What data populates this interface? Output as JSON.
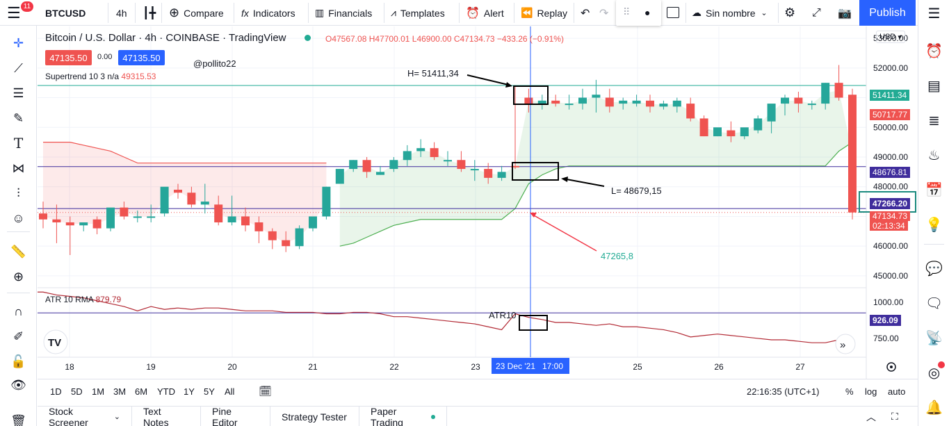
{
  "toolbar": {
    "notifications": "11",
    "symbol": "BTCUSD",
    "interval": "4h",
    "compare": "Compare",
    "indicators": "Indicators",
    "financials": "Financials",
    "templates": "Templates",
    "alert": "Alert",
    "replay": "Replay",
    "layout_name": "Sin nombre",
    "publish": "Publish"
  },
  "legend": {
    "title": "Bitcoin / U.S. Dollar · 4h · COINBASE · TradingView",
    "ohlc": "O47567.08 H47700.01 L46900.00 C47134.73 −433.26 (−0.91%)",
    "sell_price": "47135.50",
    "spread": "0.00",
    "buy_price": "47135.50",
    "supertrend_label": "Supertrend 10 3  n/a",
    "supertrend_value": "49315.53",
    "atr_label": "ATR 10 RMA",
    "atr_value": "879.79",
    "currency": "USD"
  },
  "annotations": {
    "author": "@pollito22",
    "high_note": "H= 51411,34",
    "low_note": "L= 48679,15",
    "supertrend_note": "47265,8",
    "atr_note": "ATR10"
  },
  "price_axis": {
    "ticks": [
      "53000.00",
      "52000.00",
      "51000.00",
      "50000.00",
      "49000.00",
      "48000.00",
      "47000.00",
      "46000.00",
      "45000.00"
    ],
    "atr_ticks": [
      "1000.00",
      "750.00"
    ],
    "labels": {
      "high_line": "51411.34",
      "upper_band": "50717.77",
      "low_line": "48676.81",
      "crosshair": "47266.20",
      "last_price": "47134.73",
      "countdown": "02:13:34",
      "atr_line": "926.09"
    }
  },
  "time_axis": {
    "ticks": [
      "18",
      "19",
      "20",
      "21",
      "22",
      "23",
      "25",
      "26",
      "27"
    ],
    "crosshair_label": "23 Dec '21   17:00"
  },
  "bottom": {
    "ranges": [
      "1D",
      "5D",
      "1M",
      "3M",
      "6M",
      "YTD",
      "1Y",
      "5Y",
      "All"
    ],
    "clock": "22:16:35 (UTC+1)",
    "percent": "%",
    "log": "log",
    "auto": "auto"
  },
  "tabs": [
    "Stock Screener",
    "Text Notes",
    "Pine Editor",
    "Strategy Tester",
    "Paper Trading"
  ],
  "colors": {
    "up": "#26a69a",
    "down": "#ef5350",
    "accent": "#2962ff",
    "high_line": "#22ab94",
    "low_line": "#3f2d9c",
    "atr_line": "#b22833",
    "crosshair": "#2962ff"
  },
  "chart_data": {
    "type": "candlestick",
    "ylim": [
      44600,
      53400
    ],
    "atr_ylim": [
      620,
      1100
    ],
    "candles": [
      [
        47100,
        47500,
        46900,
        46600
      ],
      [
        46900,
        47400,
        46800,
        46100
      ],
      [
        46800,
        47000,
        46700,
        45700
      ],
      [
        46700,
        46800,
        46800,
        46500
      ],
      [
        46900,
        47000,
        46600,
        46400
      ],
      [
        46600,
        47100,
        47300,
        46500
      ],
      [
        47300,
        47500,
        47000,
        46900
      ],
      [
        47000,
        47200,
        47000,
        46800
      ],
      [
        47000,
        47400,
        47000,
        46800
      ],
      [
        47100,
        47800,
        48000,
        47000
      ],
      [
        47900,
        48100,
        47800,
        47600
      ],
      [
        47800,
        48000,
        47400,
        47300
      ],
      [
        47400,
        48100,
        47500,
        47100
      ],
      [
        47400,
        47700,
        46800,
        46700
      ],
      [
        46800,
        47700,
        47000,
        46700
      ],
      [
        47000,
        47300,
        46700,
        46500
      ],
      [
        46800,
        47000,
        46500,
        46100
      ],
      [
        46500,
        46600,
        46200,
        45900
      ],
      [
        46200,
        46500,
        46000,
        45800
      ],
      [
        46000,
        46700,
        46600,
        45900
      ],
      [
        46600,
        47000,
        47000,
        46500
      ],
      [
        47000,
        48000,
        48000,
        46900
      ],
      [
        48100,
        48600,
        48600,
        48100
      ],
      [
        48600,
        48900,
        48900,
        48500
      ],
      [
        48900,
        49000,
        48500,
        48300
      ],
      [
        48400,
        48700,
        48500,
        48400
      ],
      [
        48600,
        49000,
        48900,
        48500
      ],
      [
        48900,
        49400,
        49200,
        48700
      ],
      [
        49200,
        49600,
        49300,
        49000
      ],
      [
        49300,
        49500,
        49000,
        48900
      ],
      [
        48900,
        49200,
        48900,
        48700
      ],
      [
        48900,
        49200,
        48600,
        48500
      ],
      [
        48600,
        48900,
        48600,
        48200
      ],
      [
        48600,
        48800,
        48300,
        48100
      ],
      [
        48300,
        48700,
        48500,
        48200
      ],
      [
        48700,
        51411,
        48679,
        48600
      ],
      [
        51000,
        51300,
        50800,
        50500
      ],
      [
        50800,
        51100,
        50900,
        50600
      ],
      [
        50900,
        51100,
        50800,
        50700
      ],
      [
        50800,
        51100,
        50800,
        50600
      ],
      [
        50800,
        51300,
        51000,
        50600
      ],
      [
        51000,
        51600,
        51100,
        50500
      ],
      [
        51000,
        51300,
        50700,
        50500
      ],
      [
        50800,
        51000,
        50900,
        50600
      ],
      [
        50800,
        51100,
        50900,
        50700
      ],
      [
        50900,
        51100,
        50700,
        50500
      ],
      [
        50700,
        50900,
        50800,
        50600
      ],
      [
        50700,
        51000,
        50900,
        50500
      ],
      [
        50800,
        51000,
        50300,
        50200
      ],
      [
        50300,
        50400,
        49700,
        49700
      ],
      [
        49700,
        49900,
        50000,
        49700
      ],
      [
        49900,
        50200,
        49700,
        49500
      ],
      [
        49700,
        49800,
        50000,
        49600
      ],
      [
        49900,
        50400,
        50300,
        49800
      ],
      [
        50200,
        50600,
        50800,
        49800
      ],
      [
        50800,
        51100,
        51000,
        50400
      ],
      [
        51000,
        51200,
        50800,
        50500
      ],
      [
        50800,
        50900,
        50800,
        50600
      ],
      [
        50800,
        51500,
        51500,
        50600
      ],
      [
        51500,
        52100,
        51000,
        50900
      ],
      [
        51100,
        51300,
        47134,
        46900
      ]
    ],
    "supertrend": [
      49500,
      49500,
      49500,
      49400,
      49300,
      49200,
      49000,
      48800,
      48800,
      48800,
      48800,
      48800,
      48800,
      48800,
      48800,
      48800,
      48800,
      48800,
      48800,
      48800,
      48800,
      48800,
      46000,
      46100,
      46300,
      46500,
      46700,
      46800,
      46900,
      46900,
      46900,
      46900,
      46900,
      46900,
      46900,
      47266,
      48100,
      48400,
      48600,
      48700,
      48700,
      48700,
      48700,
      48700,
      48700,
      48700,
      48700,
      48700,
      48700,
      48700,
      48700,
      48700,
      48700,
      48700,
      48700,
      48700,
      48700,
      48700,
      48700,
      49200,
      49500
    ],
    "supertrend_mode": [
      "dn",
      "dn",
      "dn",
      "dn",
      "dn",
      "dn",
      "dn",
      "dn",
      "dn",
      "dn",
      "dn",
      "dn",
      "dn",
      "dn",
      "dn",
      "dn",
      "dn",
      "dn",
      "dn",
      "dn",
      "dn",
      "dn",
      "up",
      "up",
      "up",
      "up",
      "up",
      "up",
      "up",
      "up",
      "up",
      "up",
      "up",
      "up",
      "up",
      "up",
      "up",
      "up",
      "up",
      "up",
      "up",
      "up",
      "up",
      "up",
      "up",
      "up",
      "up",
      "up",
      "up",
      "up",
      "up",
      "up",
      "up",
      "up",
      "up",
      "up",
      "up",
      "up",
      "up",
      "up",
      "up"
    ],
    "atr": [
      1070,
      1050,
      1040,
      1030,
      1010,
      990,
      970,
      940,
      970,
      950,
      960,
      950,
      960,
      960,
      950,
      940,
      940,
      940,
      930,
      930,
      930,
      920,
      920,
      930,
      930,
      920,
      900,
      900,
      890,
      880,
      870,
      860,
      850,
      830,
      810,
      920,
      895,
      880,
      860,
      860,
      850,
      840,
      850,
      830,
      830,
      820,
      810,
      790,
      760,
      770,
      780,
      770,
      760,
      750,
      740,
      740,
      730,
      720,
      720,
      740,
      740
    ],
    "h_lines": [
      51411.34,
      48676.81,
      47266.2
    ],
    "atr_h_line": 926.09
  }
}
